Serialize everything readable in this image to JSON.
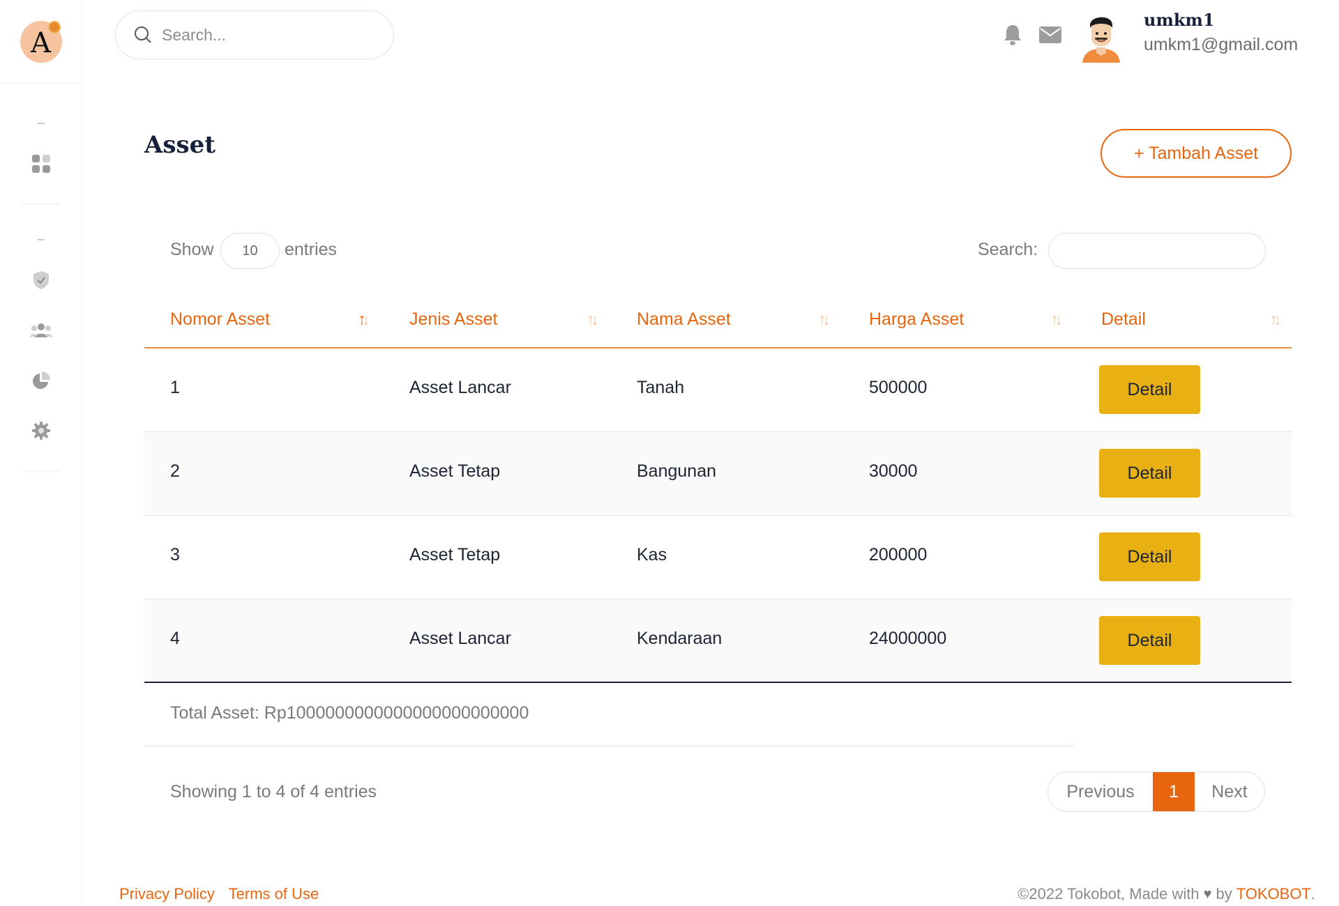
{
  "brand": {
    "logo_letter": "A",
    "logo_color": "#f7c4a0"
  },
  "search": {
    "placeholder": "Search..."
  },
  "user": {
    "name": "umkm1",
    "email": "umkm1@gmail.com"
  },
  "sidebar": {
    "icons": [
      "dashboard-icon",
      "shield-check-icon",
      "users-icon",
      "pie-chart-icon",
      "gear-icon"
    ]
  },
  "page": {
    "title": "Asset",
    "add_button": "+ Tambah Asset"
  },
  "table_controls": {
    "show_label": "Show",
    "entries_value": "10",
    "entries_label": "entries",
    "search_label": "Search:"
  },
  "table": {
    "columns": [
      "Nomor Asset",
      "Jenis Asset",
      "Nama Asset",
      "Harga Asset",
      "Detail"
    ],
    "rows": [
      {
        "no": "1",
        "jenis": "Asset Lancar",
        "nama": "Tanah",
        "harga": "500000",
        "detail": "Detail"
      },
      {
        "no": "2",
        "jenis": "Asset Tetap",
        "nama": "Bangunan",
        "harga": "30000",
        "detail": "Detail"
      },
      {
        "no": "3",
        "jenis": "Asset Tetap",
        "nama": "Kas",
        "harga": "200000",
        "detail": "Detail"
      },
      {
        "no": "4",
        "jenis": "Asset Lancar",
        "nama": "Kendaraan",
        "harga": "24000000",
        "detail": "Detail"
      }
    ]
  },
  "summary": {
    "total": "Total Asset: Rp1000000000000000000000000",
    "showing": "Showing 1 to 4 of 4 entries"
  },
  "pagination": {
    "previous": "Previous",
    "current": "1",
    "next": "Next"
  },
  "footer": {
    "privacy": "Privacy Policy",
    "terms": "Terms of Use",
    "made_with": "©2022 Tokobot, Made with",
    "by": "by",
    "brand_link": "TOKOBOT",
    "period": "."
  },
  "colors": {
    "accent": "#e8650f",
    "detail_button": "#e8b012",
    "heading": "#17203a"
  }
}
